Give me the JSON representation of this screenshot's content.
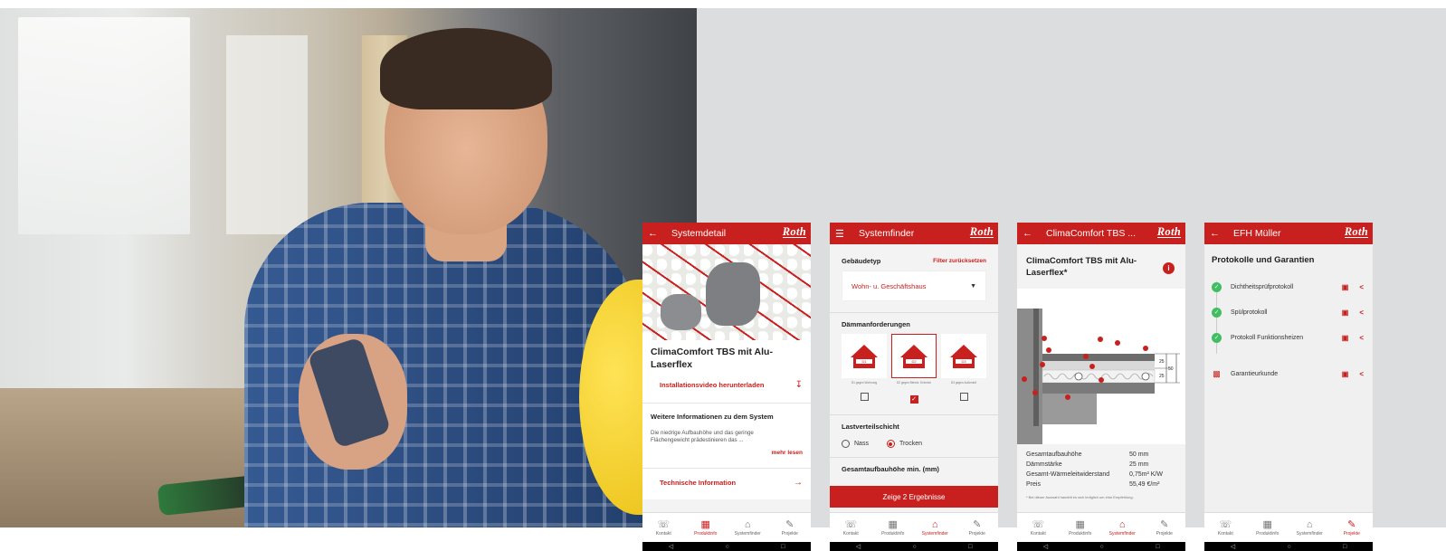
{
  "colors": {
    "brand": "#c8201e",
    "success": "#3fbf5f"
  },
  "brand_logo": "Roth",
  "nav": [
    "Kontakt",
    "Produktinfo",
    "Systemfinder",
    "Projekte"
  ],
  "phone1": {
    "title": "Systemdetail",
    "product_title": "ClimaComfort TBS mit Alu-Laserflex",
    "download_label": "Installationsvideo herunterladen",
    "more_info_heading": "Weitere Informationen zu dem System",
    "more_info_text": "Die niedrige Aufbauhöhe und das geringe Flächengewicht prädestinieren das ...",
    "read_more": "mehr lesen",
    "tech_info": "Technische Information",
    "active_nav": "Produktinfo"
  },
  "phone2": {
    "title": "Systemfinder",
    "building_type_label": "Gebäudetyp",
    "reset_filter": "Filter zurücksetzen",
    "building_type_value": "Wohn- u. Geschäftshaus",
    "insulation_label": "Dämmanforderungen",
    "insulation_options": [
      {
        "code": "D1",
        "caption": "D1 gegen Wohnung",
        "checked": false
      },
      {
        "code": "D2",
        "caption": "D2 gegen Beheiz. Erdreich",
        "checked": true
      },
      {
        "code": "D3",
        "caption": "D3 gegen Außenluft",
        "checked": false
      }
    ],
    "load_layer_label": "Lastverteilschicht",
    "load_options": [
      {
        "label": "Nass",
        "selected": false
      },
      {
        "label": "Trocken",
        "selected": true
      }
    ],
    "total_height_label": "Gesamtaufbauhöhe min. (mm)",
    "results_button": "Zeige 2 Ergebnisse",
    "active_nav": "Systemfinder"
  },
  "phone3": {
    "title": "ClimaComfort TBS ...",
    "product_title": "ClimaComfort TBS mit Alu-Laserflex*",
    "specs": [
      {
        "label": "Gesamtaufbauhöhe",
        "value": "50 mm"
      },
      {
        "label": "Dämmstärke",
        "value": "25 mm"
      },
      {
        "label": "Gesamt-Wärmeleitwiderstand",
        "value": "0,75m² K/W"
      },
      {
        "label": "Preis",
        "value": "55,49 €/m²"
      }
    ],
    "footnote": "* Bei dieser Auswahl handelt es sich lediglich um eine Empfehlung.",
    "dims": [
      "25",
      "50",
      "25"
    ],
    "active_nav": "Systemfinder"
  },
  "phone4": {
    "title": "EFH Müller",
    "heading": "Protokolle und Garantien",
    "items": [
      {
        "label": "Dichtheitsprüfprotokoll",
        "done": true
      },
      {
        "label": "Spülprotokoll",
        "done": true
      },
      {
        "label": "Protokoll Funktionsheizen",
        "done": true
      },
      {
        "label": "Garantieurkunde",
        "done": false
      }
    ],
    "active_nav": "Projekte"
  }
}
